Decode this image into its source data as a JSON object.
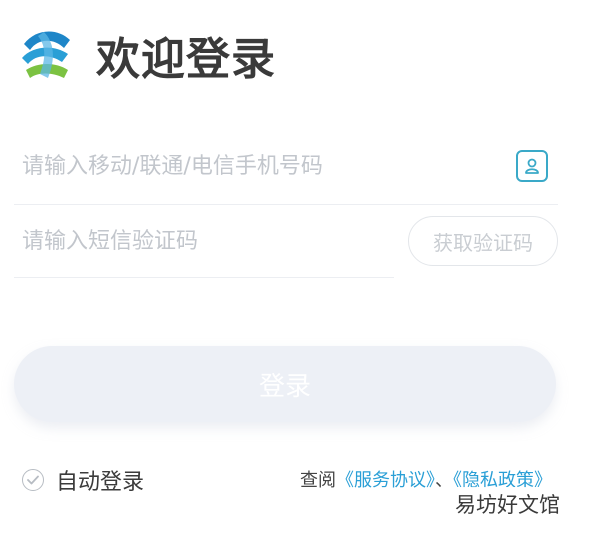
{
  "header": {
    "title": "欢迎登录",
    "logo_icon": "china-mobile-logo-icon"
  },
  "phone_field": {
    "placeholder": "请输入移动/联通/电信手机号码",
    "value": "",
    "contact_icon": "contact-person-icon"
  },
  "code_field": {
    "placeholder": "请输入短信验证码",
    "value": "",
    "get_code_label": "获取验证码"
  },
  "login_button": {
    "label": "登录"
  },
  "auto_login": {
    "label": "自动登录",
    "checked": true
  },
  "agreement": {
    "prefix": "查阅",
    "service_link": "《服务协议》",
    "separator": "、",
    "privacy_link": "《隐私政策》"
  },
  "watermark": "易坊好文馆",
  "colors": {
    "accent": "#2a9fd6",
    "icon_teal": "#3aa9c8",
    "logo_blue": "#1e86c8",
    "logo_green": "#7cc242"
  }
}
